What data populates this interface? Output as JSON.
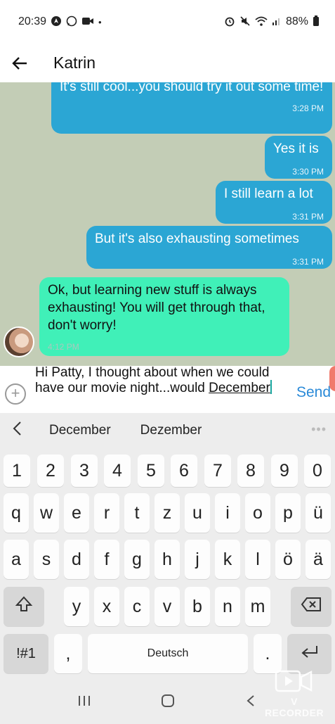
{
  "status_bar": {
    "time": "20:39",
    "battery": "88%",
    "left_icons": [
      "navigation-icon",
      "whatsapp-icon",
      "video-icon",
      "dot-icon"
    ],
    "right_icons": [
      "alarm-icon",
      "mute-icon",
      "wifi-icon",
      "signal-icon",
      "battery-icon"
    ]
  },
  "header": {
    "back_icon": "back-arrow-icon",
    "title": "Katrin"
  },
  "messages": [
    {
      "direction": "out",
      "text": "It's still cool...you should try it out some time!",
      "time": "3:28 PM"
    },
    {
      "direction": "out",
      "text": "Yes it is",
      "time": "3:30 PM"
    },
    {
      "direction": "out",
      "text": "I still learn a lot",
      "time": "3:31 PM"
    },
    {
      "direction": "out",
      "text": "But it's also exhausting sometimes",
      "time": "3:31 PM"
    },
    {
      "direction": "in",
      "text": "Ok, but learning new stuff is always exhausting! You will get through that, don't worry!",
      "time": "4:12 PM"
    }
  ],
  "compose": {
    "text_before": "Hi Patty, I thought about when we could have our movie night...would ",
    "text_current_word": "December",
    "send_label": "Send",
    "add_icon": "add-attachment-icon"
  },
  "keyboard": {
    "suggestions": [
      "December",
      "Dezember"
    ],
    "more_icon": "more-options-icon",
    "number_row": [
      "1",
      "2",
      "3",
      "4",
      "5",
      "6",
      "7",
      "8",
      "9",
      "0"
    ],
    "row1": [
      "q",
      "w",
      "e",
      "r",
      "t",
      "z",
      "u",
      "i",
      "o",
      "p",
      "ü"
    ],
    "row2": [
      "a",
      "s",
      "d",
      "f",
      "g",
      "h",
      "j",
      "k",
      "l",
      "ö",
      "ä"
    ],
    "row3": [
      "y",
      "x",
      "c",
      "v",
      "b",
      "n",
      "m"
    ],
    "symbols_label": "!#1",
    "comma": ",",
    "space_label": "Deutsch",
    "period": ".",
    "shift_icon": "shift-icon",
    "backspace_icon": "backspace-icon",
    "enter_icon": "enter-icon"
  },
  "nav_bar": {
    "icons": [
      "recents-icon",
      "home-icon",
      "back-icon"
    ]
  },
  "watermark": {
    "label": "V RECORDER"
  },
  "colors": {
    "chat_background": "#c3cdb6",
    "outgoing_bubble": "#2ba6d4",
    "incoming_bubble": "#40f0b8",
    "send_text": "#2a8ad8"
  }
}
